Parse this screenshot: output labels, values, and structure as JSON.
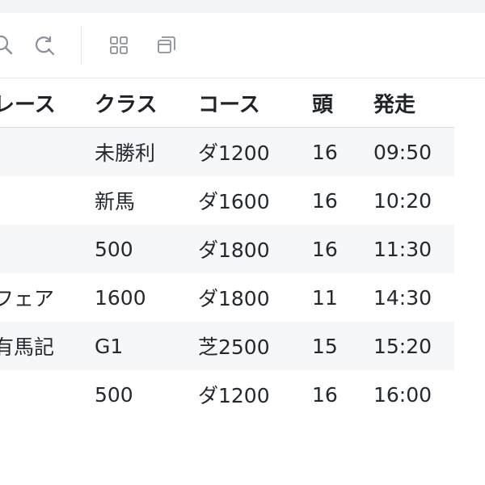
{
  "toolbar": {
    "icons": [
      "search-icon",
      "refresh-icon",
      "grid-icon",
      "window-icon"
    ]
  },
  "table": {
    "columns": [
      "レース",
      "クラス",
      "コース",
      "頭",
      "発走"
    ],
    "rows": [
      {
        "race": "",
        "class": "未勝利",
        "course": "ダ1200",
        "heads": "16",
        "start": "09:50"
      },
      {
        "race": "",
        "class": "新馬",
        "course": "ダ1600",
        "heads": "16",
        "start": "10:20"
      },
      {
        "race": "",
        "class": "500",
        "course": "ダ1800",
        "heads": "16",
        "start": "11:30"
      },
      {
        "race": "フェア",
        "class": "1600",
        "course": "ダ1800",
        "heads": "11",
        "start": "14:30"
      },
      {
        "race": "有馬記",
        "class": "G1",
        "course": "芝2500",
        "heads": "15",
        "start": "15:20"
      },
      {
        "race": "",
        "class": "500",
        "course": "ダ1200",
        "heads": "16",
        "start": "16:00"
      }
    ]
  }
}
